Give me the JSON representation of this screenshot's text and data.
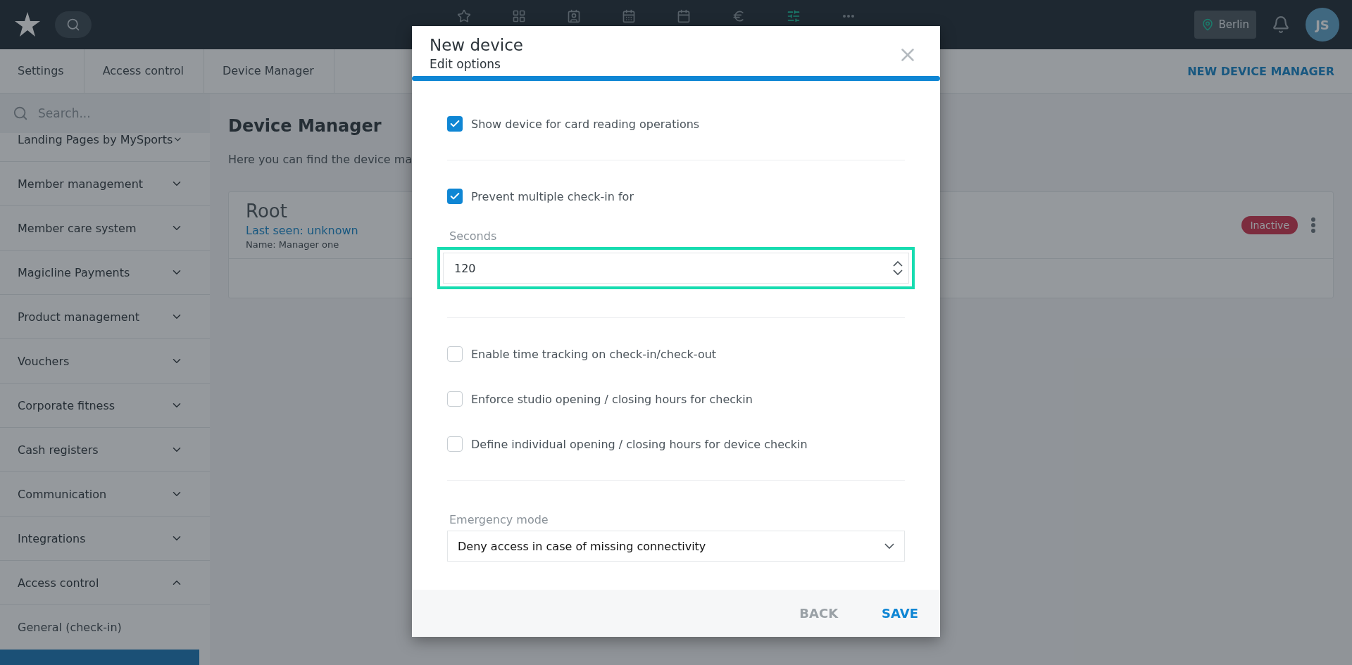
{
  "topbar": {
    "nav_icons": [
      {
        "kind": "star",
        "selected": false
      },
      {
        "kind": "layout",
        "selected": false
      },
      {
        "kind": "contacts",
        "selected": false
      },
      {
        "kind": "calendar-day",
        "selected": false
      },
      {
        "kind": "calendar",
        "selected": false
      },
      {
        "kind": "euro",
        "selected": false
      },
      {
        "kind": "sliders",
        "selected": true
      },
      {
        "kind": "more",
        "selected": false
      }
    ],
    "location": "Berlin",
    "avatar": "JS"
  },
  "breadcrumbs": [
    "Settings",
    "Access control",
    "Device Manager"
  ],
  "action": "NEW DEVICE MANAGER",
  "sidebar": {
    "search_placeholder": "Search...",
    "items": [
      {
        "label": "Landing Pages by MySports",
        "expanded": false
      },
      {
        "label": "Member management",
        "expanded": false
      },
      {
        "label": "Member care system",
        "expanded": false
      },
      {
        "label": "Magicline Payments",
        "expanded": false
      },
      {
        "label": "Product management",
        "expanded": false
      },
      {
        "label": "Vouchers",
        "expanded": false
      },
      {
        "label": "Corporate fitness",
        "expanded": false
      },
      {
        "label": "Cash registers",
        "expanded": false
      },
      {
        "label": "Communication",
        "expanded": false
      },
      {
        "label": "Integrations",
        "expanded": false
      },
      {
        "label": "Access control",
        "expanded": true,
        "children": [
          {
            "label": "General (check-in)",
            "selected": false
          },
          {
            "selected": true
          }
        ]
      }
    ]
  },
  "main": {
    "title": "Device Manager",
    "description": "Here you can find the device ma",
    "device": {
      "name": "Root",
      "last_seen": "Last seen: unknown",
      "detail": "Name: Manager one",
      "status": "Inactive"
    }
  },
  "modal": {
    "title": "New device",
    "subtitle": "Edit options",
    "progress": {
      "level": 1
    },
    "sections": [
      [
        {
          "kind": "checkbox",
          "label": "Show device for card reading operations",
          "checked": true
        }
      ],
      [
        {
          "kind": "checkbox",
          "label": "Prevent multiple check-in for",
          "checked": true
        },
        {
          "kind": "number",
          "label": "Seconds",
          "value": "120",
          "focused": true
        }
      ],
      [
        {
          "kind": "checkbox",
          "label": "Enable time tracking on check-in/check-out",
          "checked": false
        },
        {
          "kind": "checkbox",
          "label": "Enforce studio opening / closing hours for checkin",
          "checked": false
        },
        {
          "kind": "checkbox",
          "label": "Define individual opening / closing hours for device checkin",
          "checked": false
        }
      ],
      [
        {
          "kind": "select",
          "label": "Emergency mode",
          "value": "Deny access in case of missing connectivity"
        }
      ]
    ],
    "buttons": [
      {
        "label": "BACK",
        "primary": false
      },
      {
        "label": "SAVE",
        "primary": true
      }
    ]
  }
}
